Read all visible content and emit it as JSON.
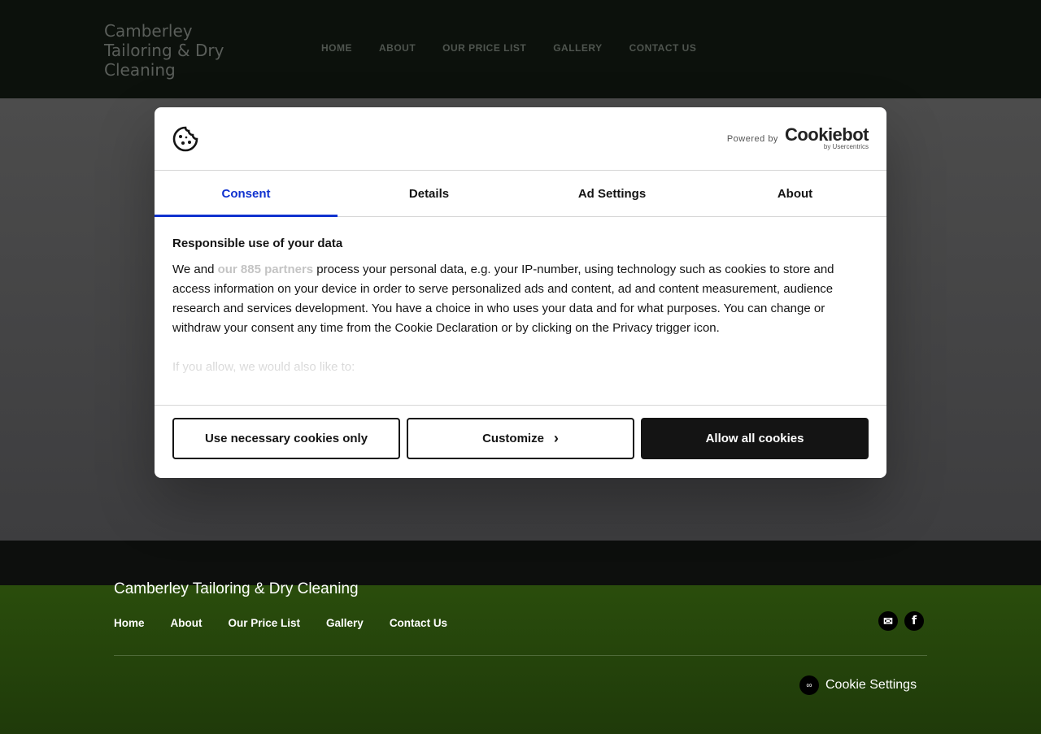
{
  "site": {
    "logo": "Camberley Tailoring & Dry Cleaning",
    "nav": [
      "HOME",
      "ABOUT",
      "OUR PRICE LIST",
      "GALLERY",
      "CONTACT US"
    ]
  },
  "footer": {
    "title": "Camberley Tailoring & Dry Cleaning",
    "nav": [
      "Home",
      "About",
      "Our Price List",
      "Gallery",
      "Contact Us"
    ],
    "social": [
      "email-icon",
      "facebook-icon"
    ],
    "cookie_settings": "Cookie Settings"
  },
  "dialog": {
    "powered_by": "Powered by",
    "brand": "Cookiebot",
    "brand_sub": "by Usercentrics",
    "tabs": [
      "Consent",
      "Details",
      "Ad Settings",
      "About"
    ],
    "active_tab": "Consent",
    "heading": "Responsible use of your data",
    "text_before": "We and ",
    "partners_link": "our 885 partners",
    "text_after": " process your personal data, e.g. your IP-number, using technology such as cookies to store and access information on your device in order to serve personalized ads and content, ad and content measurement, audience research and services development. You have a choice in who uses your data and for what purposes. You can change or withdraw your consent any time from the Cookie Declaration or by clicking on the Privacy trigger icon.",
    "faded": "If you allow, we would also like to:",
    "buttons": {
      "necessary": "Use necessary cookies only",
      "customize": "Customize",
      "allow": "Allow all cookies"
    },
    "accent": "#1032cf"
  }
}
